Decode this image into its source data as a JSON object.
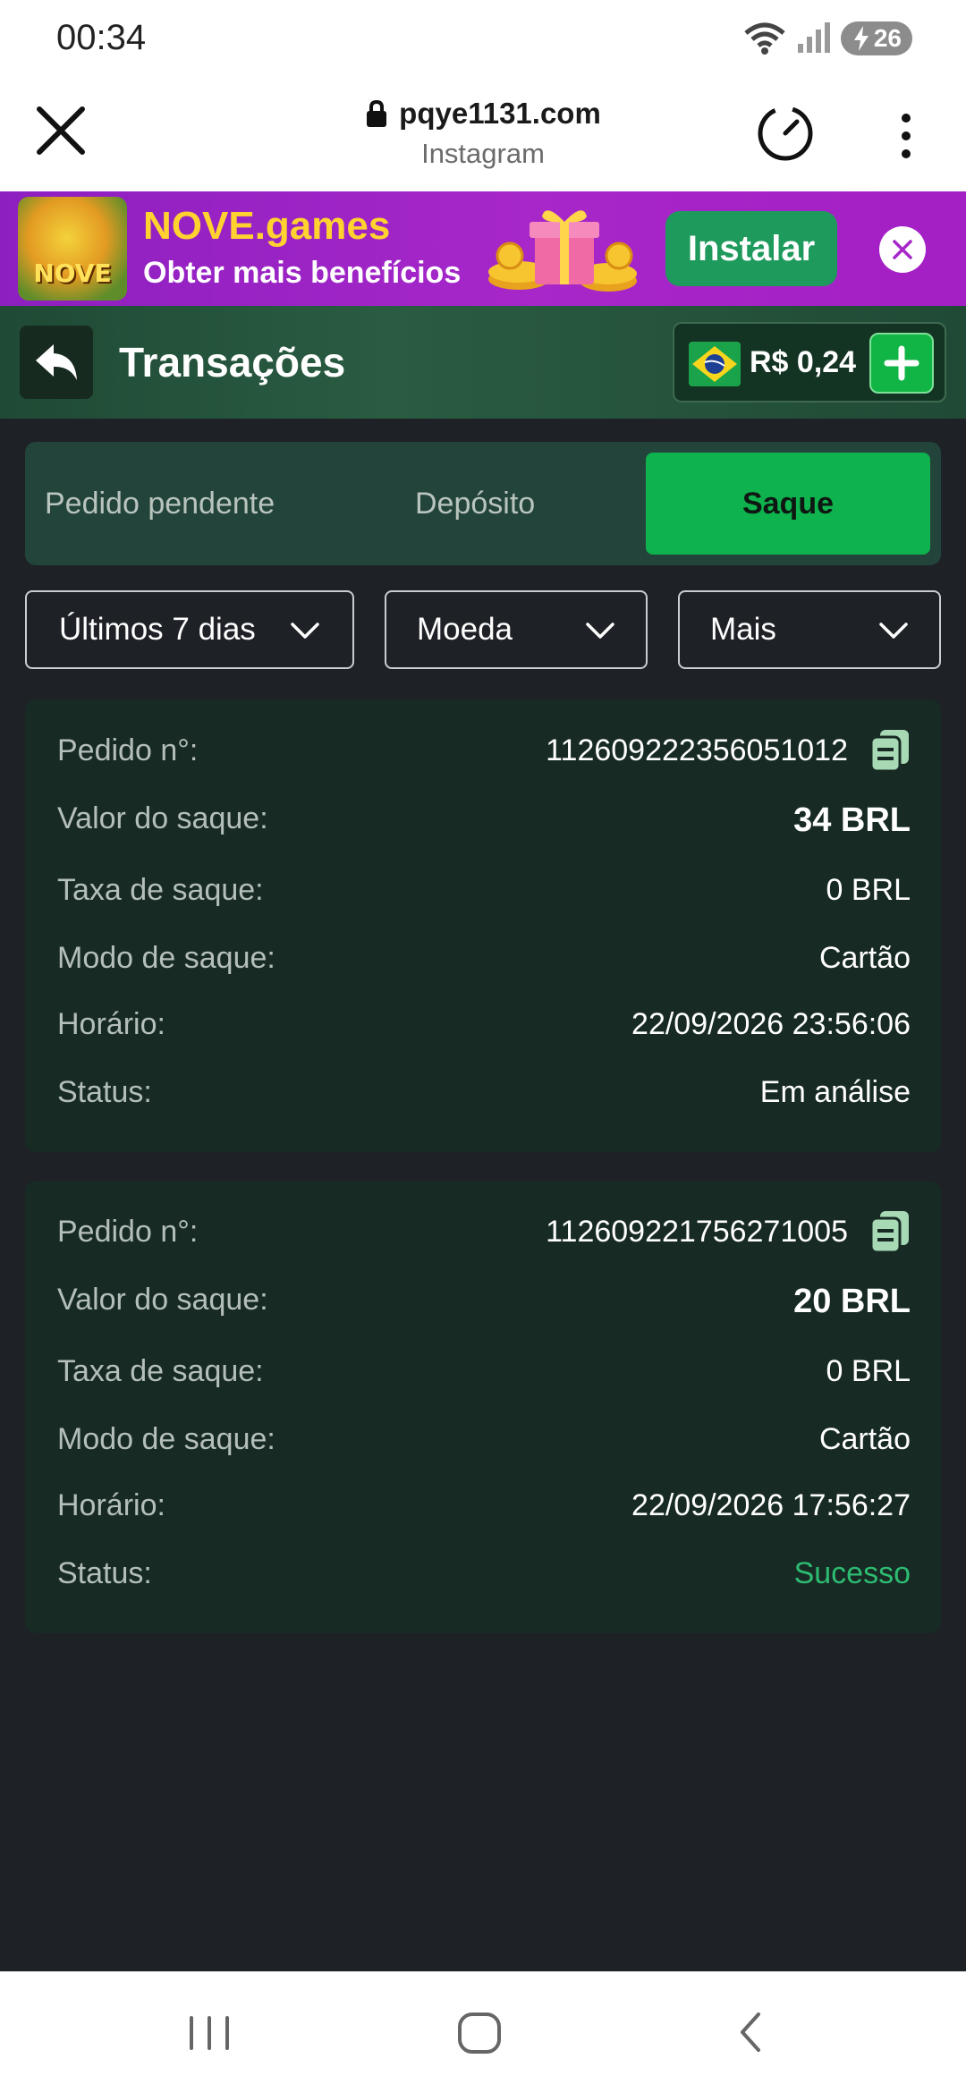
{
  "status_bar": {
    "time": "00:34",
    "battery": "26"
  },
  "browser": {
    "domain": "pqye1131.com",
    "source": "Instagram"
  },
  "banner": {
    "logo_text": "NOVE",
    "title": "NOVE.games",
    "subtitle": "Obter mais benefícios",
    "install_label": "Instalar"
  },
  "header": {
    "title": "Transações",
    "balance": "R$ 0,24"
  },
  "tabs": [
    {
      "label": "Pedido pendente"
    },
    {
      "label": "Depósito"
    },
    {
      "label": "Saque"
    }
  ],
  "filters": {
    "period": "Últimos 7 dias",
    "currency": "Moeda",
    "more": "Mais"
  },
  "labels": {
    "order_no": "Pedido n°:",
    "amount": "Valor do saque:",
    "fee": "Taxa de saque:",
    "mode": "Modo de saque:",
    "time": "Horário:",
    "status": "Status:"
  },
  "transactions": [
    {
      "order_no": "112609222356051012",
      "amount": "34 BRL",
      "fee": "0 BRL",
      "mode": "Cartão",
      "time": "22/09/2026 23:56:06",
      "status": "Em análise"
    },
    {
      "order_no": "112609221756271005",
      "amount": "20 BRL",
      "fee": "0 BRL",
      "mode": "Cartão",
      "time": "22/09/2026 17:56:27",
      "status": "Sucesso"
    }
  ],
  "colors": {
    "accent_green": "#0fb34e",
    "success": "#2dbb71",
    "banner_purple": "#a727c9"
  }
}
